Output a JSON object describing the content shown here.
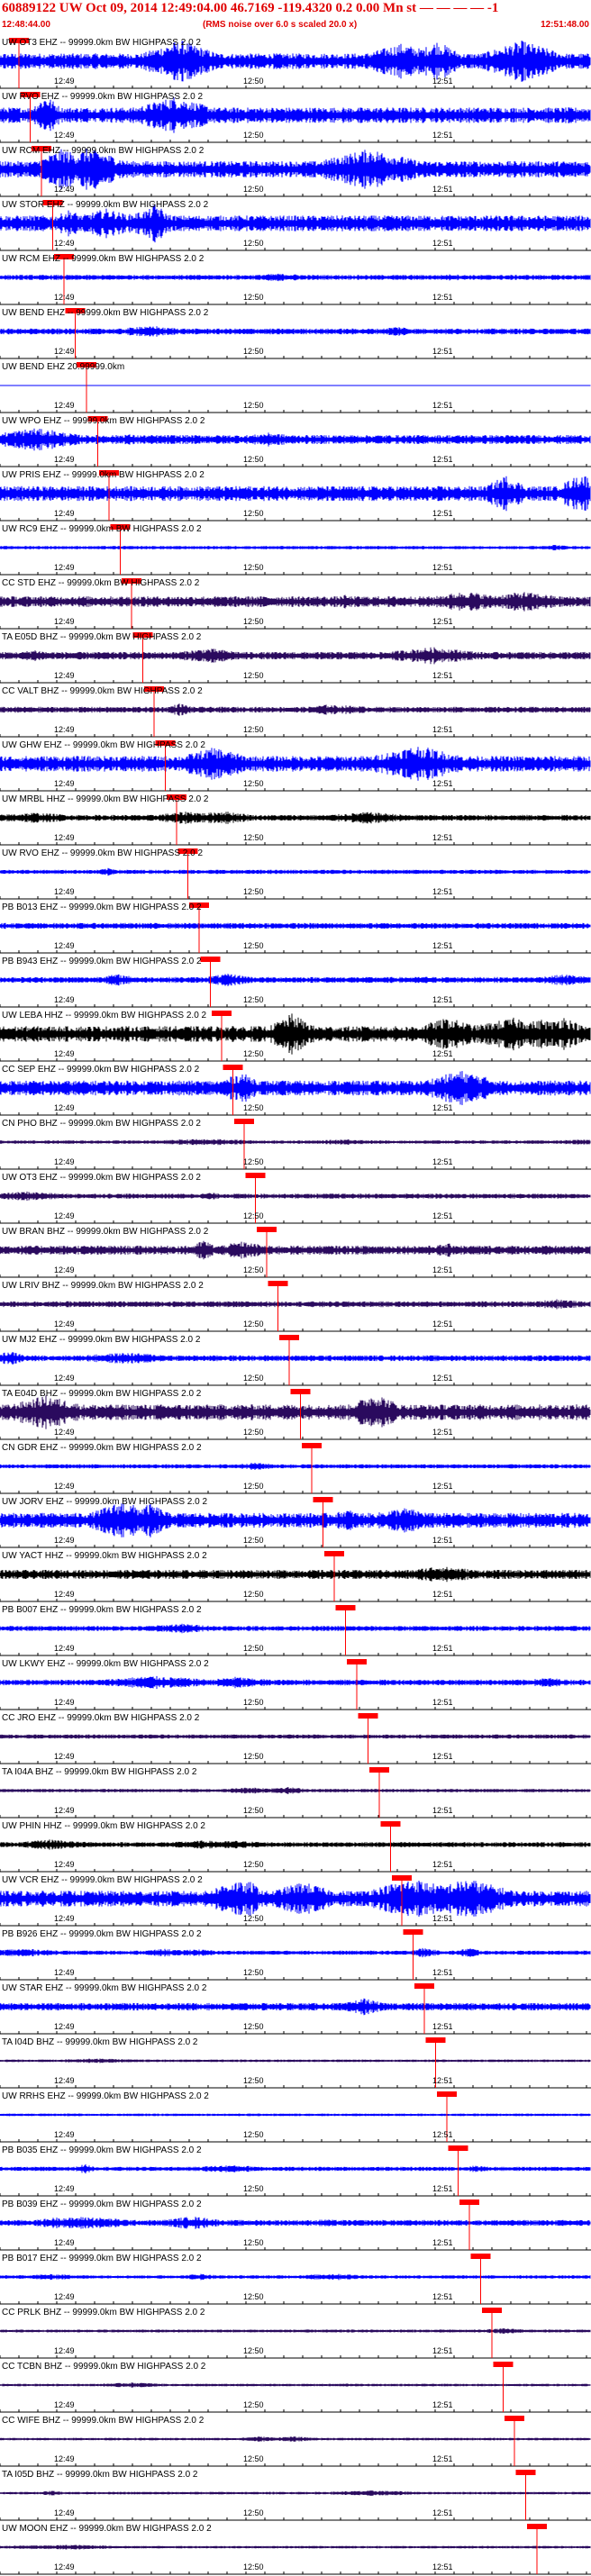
{
  "header": {
    "title": "60889122 UW Oct 09, 2014 12:49:04.00   46.7169 -119.4320  0.2 0.00  Mn st — — — — -1",
    "start_time": "12:48:44.00",
    "note": "(RMS noise over 6.0 s scaled 20.0 x)",
    "end_time": "12:51:48.00"
  },
  "tick_labels": [
    "12:49",
    "12:50",
    "12:51"
  ],
  "colors": {
    "blue": "#0000ff",
    "purple": "#2a0a5e",
    "black": "#000000",
    "red": "#ff0000"
  },
  "traces": [
    {
      "label": "UW OT3 EHZ -- 99999.0km BW  HIGHPASS  2.0  2",
      "color": "#0000ff",
      "amp": 0.9,
      "burst": 0.8
    },
    {
      "label": "UW RVO EHZ -- 99999.0km BW  HIGHPASS  2.0  2",
      "color": "#0000ff",
      "amp": 0.9,
      "burst": 0.8
    },
    {
      "label": "UW RCM EHZ -- 99999.0km BW  HIGHPASS  2.0  2",
      "color": "#0000ff",
      "amp": 0.95,
      "burst": 0.9
    },
    {
      "label": "UW STOR EHZ -- 99999.0km BW  HIGHPASS  2.0  2",
      "color": "#0000ff",
      "amp": 0.9,
      "burst": 0.6
    },
    {
      "label": "UW RCM EHZ -- 99999.0km BW  HIGHPASS  2.0  2",
      "color": "#0000ff",
      "amp": 0.25,
      "burst": 0.2
    },
    {
      "label": "UW BEND EHZ -- 99999.0km BW  HIGHPASS  2.0  2",
      "color": "#0000ff",
      "amp": 0.3,
      "burst": 0.2
    },
    {
      "label": "UW BEND EHZ 20.99999.0km",
      "color": "#0000ff",
      "amp": 0.0,
      "burst": 0.0
    },
    {
      "label": "UW WPO EHZ -- 99999.0km BW  HIGHPASS  2.0  2",
      "color": "#0000ff",
      "amp": 0.5,
      "burst": 0.3
    },
    {
      "label": "UW PRIS EHZ -- 99999.0km BW  HIGHPASS  2.0  2",
      "color": "#0000ff",
      "amp": 0.85,
      "burst": 0.7
    },
    {
      "label": "UW RC9 EHZ -- 99999.0km BW  HIGHPASS  2.0  2",
      "color": "#0000ff",
      "amp": 0.15,
      "burst": 0.1
    },
    {
      "label": "CC STD EHZ -- 99999.0km BW  HIGHPASS  2.0  2",
      "color": "#2a0a5e",
      "amp": 0.6,
      "burst": 0.4
    },
    {
      "label": "TA E05D BHZ -- 99999.0km BW  HIGHPASS  2.0  2",
      "color": "#2a0a5e",
      "amp": 0.4,
      "burst": 0.3
    },
    {
      "label": "CC VALT BHZ -- 99999.0km BW  HIGHPASS  2.0  2",
      "color": "#2a0a5e",
      "amp": 0.3,
      "burst": 0.2
    },
    {
      "label": "UW GHW EHZ -- 99999.0km BW  HIGHPASS  2.0  2",
      "color": "#0000ff",
      "amp": 0.9,
      "burst": 0.7
    },
    {
      "label": "UW MRBL HHZ -- 99999.0km BW  HIGHPASS  2.0  2",
      "color": "#000000",
      "amp": 0.3,
      "burst": 0.2
    },
    {
      "label": "UW RVO EHZ -- 99999.0km BW  HIGHPASS  2.0  2",
      "color": "#0000ff",
      "amp": 0.2,
      "burst": 0.1
    },
    {
      "label": "PB B013 EHZ -- 99999.0km BW  HIGHPASS  2.0  2",
      "color": "#0000ff",
      "amp": 0.3,
      "burst": 0.2
    },
    {
      "label": "PB B943 EHZ -- 99999.0km BW  HIGHPASS  2.0  2",
      "color": "#0000ff",
      "amp": 0.3,
      "burst": 0.2
    },
    {
      "label": "UW LEBA HHZ -- 99999.0km BW  HIGHPASS  2.0  2",
      "color": "#000000",
      "amp": 0.9,
      "burst": 0.6
    },
    {
      "label": "CC SEP EHZ -- 99999.0km BW  HIGHPASS  2.0  2",
      "color": "#0000ff",
      "amp": 0.85,
      "burst": 0.5
    },
    {
      "label": "CN PHO BHZ -- 99999.0km BW  HIGHPASS  2.0  2",
      "color": "#2a0a5e",
      "amp": 0.15,
      "burst": 0.1
    },
    {
      "label": "UW OT3 EHZ -- 99999.0km BW  HIGHPASS  2.0  2",
      "color": "#2a0a5e",
      "amp": 0.25,
      "burst": 0.15
    },
    {
      "label": "UW BRAN BHZ -- 99999.0km BW  HIGHPASS  2.0  2",
      "color": "#2a0a5e",
      "amp": 0.5,
      "burst": 0.3
    },
    {
      "label": "UW LRIV BHZ -- 99999.0km BW  HIGHPASS  2.0  2",
      "color": "#2a0a5e",
      "amp": 0.3,
      "burst": 0.2
    },
    {
      "label": "UW MJ2 EHZ -- 99999.0km BW  HIGHPASS  2.0  2",
      "color": "#0000ff",
      "amp": 0.3,
      "burst": 0.2
    },
    {
      "label": "TA E04D BHZ -- 99999.0km BW  HIGHPASS  2.0  2",
      "color": "#2a0a5e",
      "amp": 0.9,
      "burst": 0.6
    },
    {
      "label": "CN GDR EHZ -- 99999.0km BW  HIGHPASS  2.0  2",
      "color": "#0000ff",
      "amp": 0.2,
      "burst": 0.1
    },
    {
      "label": "UW JORV EHZ -- 99999.0km BW  HIGHPASS  2.0  2",
      "color": "#0000ff",
      "amp": 0.85,
      "burst": 0.5
    },
    {
      "label": "UW YACT HHZ -- 99999.0km BW  HIGHPASS  2.0  2",
      "color": "#000000",
      "amp": 0.5,
      "burst": 0.3
    },
    {
      "label": "PB B007 EHZ -- 99999.0km BW  HIGHPASS  2.0  2",
      "color": "#0000ff",
      "amp": 0.25,
      "burst": 0.15
    },
    {
      "label": "UW LKWY EHZ -- 99999.0km BW  HIGHPASS  2.0  2",
      "color": "#0000ff",
      "amp": 0.3,
      "burst": 0.2
    },
    {
      "label": "CC JRO EHZ -- 99999.0km BW  HIGHPASS  2.0  2",
      "color": "#2a0a5e",
      "amp": 0.2,
      "burst": 0.15
    },
    {
      "label": "TA I04A BHZ -- 99999.0km BW  HIGHPASS  2.0  2",
      "color": "#2a0a5e",
      "amp": 0.15,
      "burst": 0.1
    },
    {
      "label": "UW PHIN HHZ -- 99999.0km BW  HIGHPASS  2.0  2",
      "color": "#000000",
      "amp": 0.25,
      "burst": 0.1
    },
    {
      "label": "UW VCR EHZ -- 99999.0km BW  HIGHPASS  2.0  2",
      "color": "#0000ff",
      "amp": 0.9,
      "burst": 0.7
    },
    {
      "label": "PB B926 EHZ -- 99999.0km BW  HIGHPASS  2.0  2",
      "color": "#0000ff",
      "amp": 0.2,
      "burst": 0.1
    },
    {
      "label": "UW STAR EHZ -- 99999.0km BW  HIGHPASS  2.0  2",
      "color": "#0000ff",
      "amp": 0.4,
      "burst": 0.2
    },
    {
      "label": "TA I04D BHZ -- 99999.0km BW  HIGHPASS  2.0  2",
      "color": "#2a0a5e",
      "amp": 0.1,
      "burst": 0.05
    },
    {
      "label": "UW RRHS EHZ -- 99999.0km BW  HIGHPASS  2.0  2",
      "color": "#0000ff",
      "amp": 0.1,
      "burst": 0.05
    },
    {
      "label": "PB B035 EHZ -- 99999.0km BW  HIGHPASS  2.0  2",
      "color": "#0000ff",
      "amp": 0.2,
      "burst": 0.1
    },
    {
      "label": "PB B039 EHZ -- 99999.0km BW  HIGHPASS  2.0  2",
      "color": "#0000ff",
      "amp": 0.3,
      "burst": 0.15
    },
    {
      "label": "PB B017 EHZ -- 99999.0km BW  HIGHPASS  2.0  2",
      "color": "#0000ff",
      "amp": 0.15,
      "burst": 0.1
    },
    {
      "label": "CC PRLK BHZ -- 99999.0km BW  HIGHPASS  2.0  2",
      "color": "#2a0a5e",
      "amp": 0.12,
      "burst": 0.05
    },
    {
      "label": "CC TCBN BHZ -- 99999.0km BW  HIGHPASS  2.0  2",
      "color": "#2a0a5e",
      "amp": 0.1,
      "burst": 0.05
    },
    {
      "label": "CC WIFE BHZ -- 99999.0km BW  HIGHPASS  2.0  2",
      "color": "#2a0a5e",
      "amp": 0.1,
      "burst": 0.05
    },
    {
      "label": "TA I05D BHZ -- 99999.0km BW  HIGHPASS  2.0  2",
      "color": "#2a0a5e",
      "amp": 0.1,
      "burst": 0.05
    },
    {
      "label": "UW MOON EHZ -- 99999.0km BW  HIGHPASS  2.0  2",
      "color": "#2a0a5e",
      "amp": 0.1,
      "burst": 0.05
    }
  ]
}
